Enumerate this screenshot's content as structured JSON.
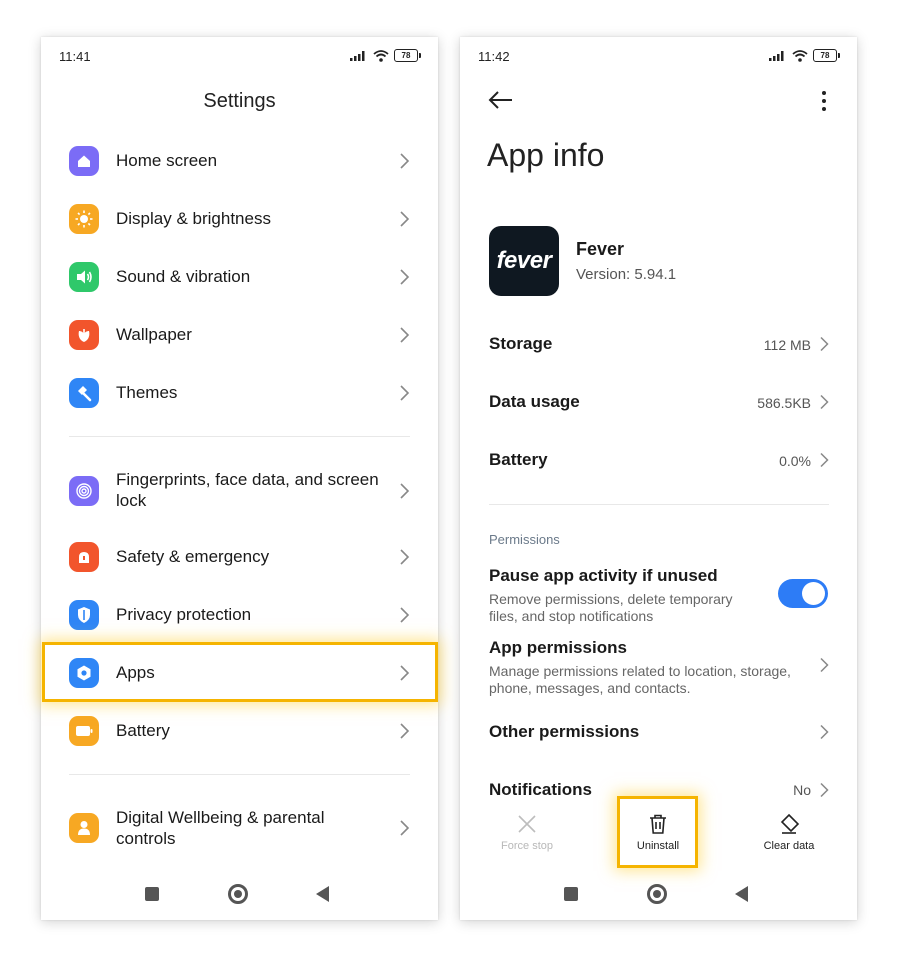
{
  "left_phone": {
    "status": {
      "time": "11:41",
      "battery": "78"
    },
    "title": "Settings",
    "items": [
      {
        "label": "Home screen",
        "icon": "home-icon",
        "color": "#7b6cf6"
      },
      {
        "label": "Display & brightness",
        "icon": "sun-icon",
        "color": "#f7a823"
      },
      {
        "label": "Sound & vibration",
        "icon": "speaker-icon",
        "color": "#2fc86a"
      },
      {
        "label": "Wallpaper",
        "icon": "flower-icon",
        "color": "#f2552c"
      },
      {
        "label": "Themes",
        "icon": "brush-icon",
        "color": "#2f86f6"
      },
      {
        "label": "Fingerprints, face data, and screen lock",
        "icon": "fingerprint-icon",
        "color": "#7b6cf6"
      },
      {
        "label": "Safety & emergency",
        "icon": "alarm-icon",
        "color": "#f2552c"
      },
      {
        "label": "Privacy protection",
        "icon": "shield-icon",
        "color": "#2f86f6"
      },
      {
        "label": "Apps",
        "icon": "apps-gear-icon",
        "color": "#2f86f6"
      },
      {
        "label": "Battery",
        "icon": "battery-icon",
        "color": "#f7a823"
      },
      {
        "label": "Digital Wellbeing & parental controls",
        "icon": "wellbeing-icon",
        "color": "#f7a823"
      }
    ]
  },
  "right_phone": {
    "status": {
      "time": "11:42",
      "battery": "78"
    },
    "title": "App info",
    "app": {
      "name": "Fever",
      "version": "Version: 5.94.1",
      "logo_text": "fever"
    },
    "rows": [
      {
        "label": "Storage",
        "value": "112 MB"
      },
      {
        "label": "Data usage",
        "value": "586.5KB"
      },
      {
        "label": "Battery",
        "value": "0.0%"
      }
    ],
    "permissions_header": "Permissions",
    "pause": {
      "title": "Pause app activity if unused",
      "desc": "Remove permissions, delete temporary files, and stop notifications",
      "enabled": true
    },
    "app_permissions": {
      "title": "App permissions",
      "desc": "Manage permissions related to location, storage, phone, messages, and contacts."
    },
    "other_permissions": "Other permissions",
    "notifications": {
      "label": "Notifications",
      "value": "No"
    },
    "actions": {
      "force_stop": "Force stop",
      "uninstall": "Uninstall",
      "clear_data": "Clear data"
    }
  },
  "colors": {
    "highlight": "#f5b400",
    "toggle": "#2d7cf6",
    "fever_bg": "#0f1821"
  }
}
